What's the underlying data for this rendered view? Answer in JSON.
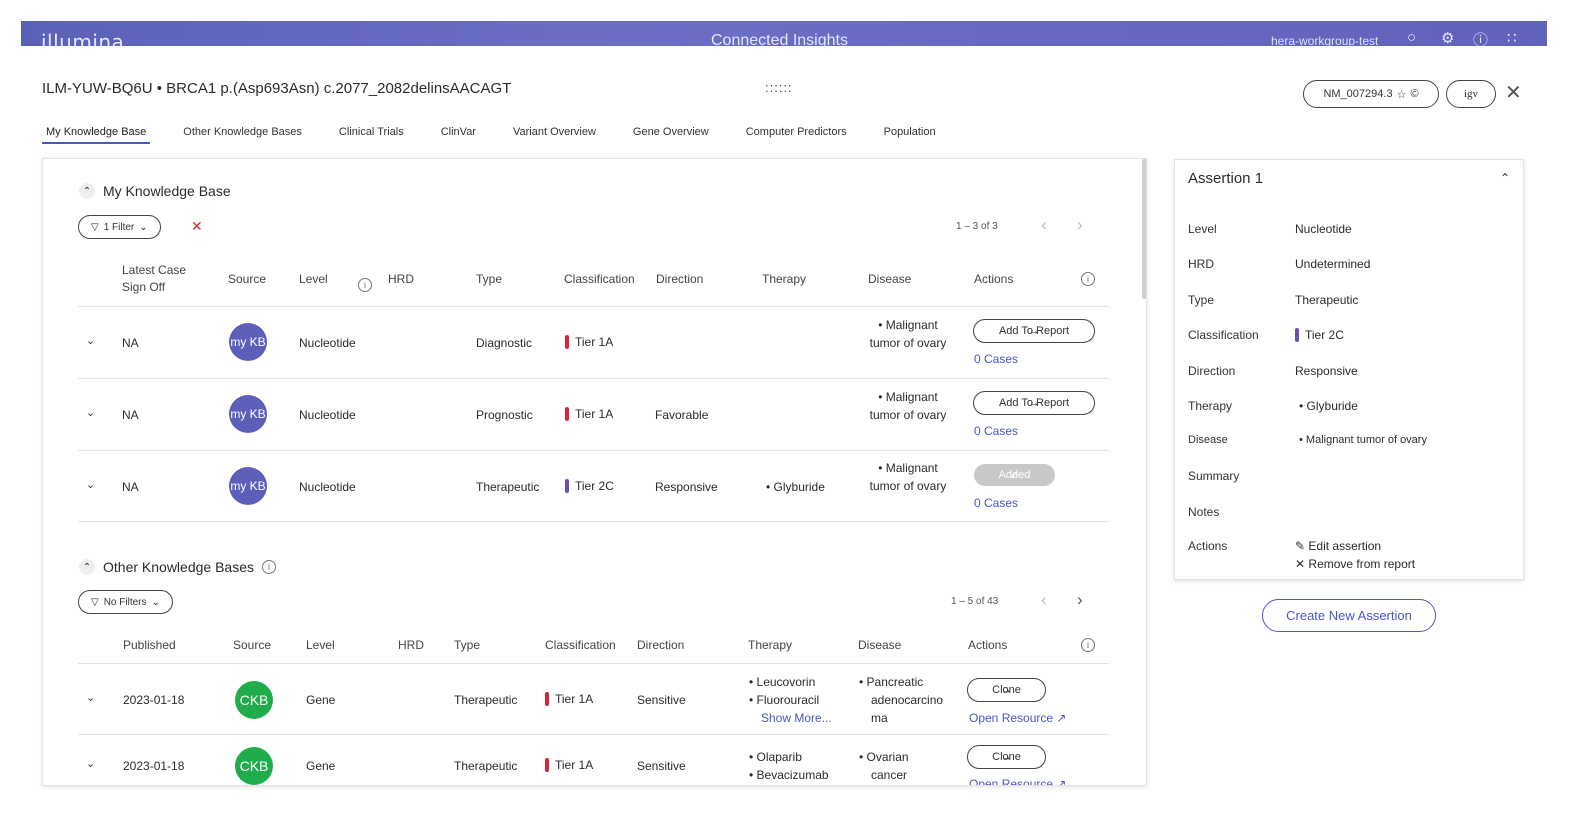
{
  "topbar": {
    "logo": "illumina",
    "app_title": "Connected Insights",
    "user": "hera-workgroup-test",
    "icons": [
      "user-icon",
      "gear-icon",
      "help-icon",
      "apps-grid-icon"
    ]
  },
  "header": {
    "title": "ILM-YUW-BQ6U •  BRCA1 p.(Asp693Asn) c.2077_2082delinsAACAGT",
    "drag_handle": "::::::",
    "transcript": "NM_007294.3",
    "igv": "igv",
    "close": "✕"
  },
  "tabs": [
    {
      "label": "My Knowledge Base",
      "active": true
    },
    {
      "label": "Other Knowledge Bases"
    },
    {
      "label": "Clinical Trials"
    },
    {
      "label": "ClinVar"
    },
    {
      "label": "Variant Overview"
    },
    {
      "label": "Gene Overview"
    },
    {
      "label": "Computer Predictors"
    },
    {
      "label": "Population"
    }
  ],
  "my_kb": {
    "title": "My Knowledge Base",
    "filter_label": "1 Filter",
    "pager": "1 – 3 of 3",
    "columns": {
      "sign_off": "Latest Case Sign Off",
      "source": "Source",
      "level": "Level",
      "hrd": "HRD",
      "type": "Type",
      "classification": "Classification",
      "direction": "Direction",
      "therapy": "Therapy",
      "disease": "Disease",
      "actions": "Actions"
    },
    "rows": [
      {
        "sign_off": "NA",
        "source": "my KB",
        "level": "Nucleotide",
        "type": "Diagnostic",
        "tier": "Tier 1A",
        "tier_color": "#d9253a",
        "direction": "",
        "therapy": "",
        "disease": "• Malignant tumor of ovary",
        "action": "Add To Report",
        "cases": "0 Cases"
      },
      {
        "sign_off": "NA",
        "source": "my KB",
        "level": "Nucleotide",
        "type": "Prognostic",
        "tier": "Tier 1A",
        "tier_color": "#d9253a",
        "direction": "Favorable",
        "therapy": "",
        "disease": "• Malignant tumor of ovary",
        "action": "Add To Report",
        "cases": "0 Cases"
      },
      {
        "sign_off": "NA",
        "source": "my KB",
        "level": "Nucleotide",
        "type": "Therapeutic",
        "tier": "Tier 2C",
        "tier_color": "#6b4fb5",
        "direction": "Responsive",
        "therapy": "• Glyburide",
        "disease": "• Malignant tumor of ovary",
        "action": "Added",
        "cases": "0 Cases"
      }
    ]
  },
  "other_kb": {
    "title": "Other Knowledge Bases",
    "filter_label": "No Filters",
    "pager": "1 – 5 of 43",
    "columns": {
      "published": "Published",
      "source": "Source",
      "level": "Level",
      "hrd": "HRD",
      "type": "Type",
      "classification": "Classification",
      "direction": "Direction",
      "therapy": "Therapy",
      "disease": "Disease",
      "actions": "Actions"
    },
    "rows": [
      {
        "published": "2023-01-18",
        "source": "CKB",
        "level": "Gene",
        "type": "Therapeutic",
        "tier": "Tier 1A",
        "tier_color": "#d9253a",
        "direction": "Sensitive",
        "therapy_1": "• Leucovorin",
        "therapy_2": "• Fluorouracil",
        "show_more": "Show More...",
        "disease_1": "• Pancreatic",
        "disease_2": "adenocarcino",
        "disease_3": "ma",
        "action": "Clone",
        "resource": "Open Resource"
      },
      {
        "published": "2023-01-18",
        "source": "CKB",
        "level": "Gene",
        "type": "Therapeutic",
        "tier": "Tier 1A",
        "tier_color": "#d9253a",
        "direction": "Sensitive",
        "therapy_1": "• Olaparib",
        "therapy_2": "• Bevacizumab",
        "disease_1": "• Ovarian",
        "disease_2": "cancer",
        "action": "Clone",
        "resource": "Open Resource"
      }
    ]
  },
  "assertion": {
    "title": "Assertion 1",
    "fields": [
      {
        "k": "Level",
        "v": "Nucleotide"
      },
      {
        "k": "HRD",
        "v": "Undetermined"
      },
      {
        "k": "Type",
        "v": "Therapeutic"
      },
      {
        "k": "Classification",
        "v": "Tier 2C"
      },
      {
        "k": "Direction",
        "v": "Responsive"
      },
      {
        "k": "Therapy",
        "v": "• Glyburide"
      },
      {
        "k": "Disease",
        "v": "• Malignant tumor of ovary"
      },
      {
        "k": "Summary",
        "v": ""
      },
      {
        "k": "Notes",
        "v": ""
      },
      {
        "k": "Actions",
        "v": ""
      }
    ],
    "tier_color": "#6b4fb5",
    "edit_label": "Edit assertion",
    "remove_label": "Remove from report"
  },
  "create_button": "Create New Assertion"
}
